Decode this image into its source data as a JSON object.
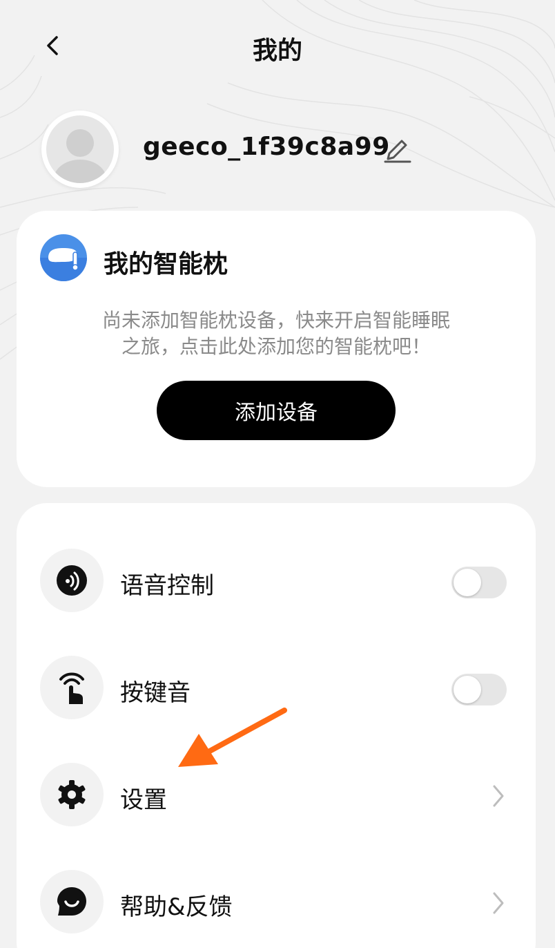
{
  "header": {
    "title": "我的"
  },
  "profile": {
    "username": "geeco_1f39c8a99"
  },
  "device_card": {
    "title": "我的智能枕",
    "description_line1": "尚未添加智能枕设备，快来开启智能睡眠",
    "description_line2": "之旅，点击此处添加您的智能枕吧！",
    "button_label": "添加设备"
  },
  "menu": {
    "items": [
      {
        "label": "语音控制",
        "icon": "voice-icon",
        "control": "toggle",
        "on": false
      },
      {
        "label": "按键音",
        "icon": "tap-icon",
        "control": "toggle",
        "on": false
      },
      {
        "label": "设置",
        "icon": "gear-icon",
        "control": "chevron"
      },
      {
        "label": "帮助&反馈",
        "icon": "chat-icon",
        "control": "chevron"
      }
    ]
  },
  "colors": {
    "accent_orange": "#ff6a13",
    "device_blue": "#4a90e8",
    "button_black": "#000000"
  }
}
